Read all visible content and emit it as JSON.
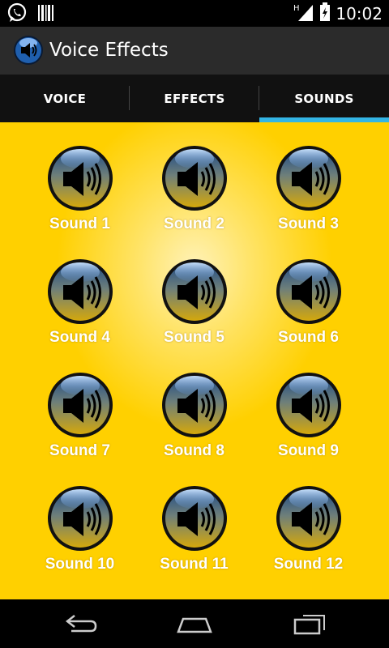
{
  "status_bar": {
    "time": "10:02",
    "icons": [
      "whatsapp-icon",
      "barcode-icon",
      "signal-icon",
      "battery-icon"
    ]
  },
  "action_bar": {
    "title": "Voice Effects",
    "icon": "speaker-icon"
  },
  "tabs": [
    {
      "label": "VOICE",
      "selected": false
    },
    {
      "label": "EFFECTS",
      "selected": false
    },
    {
      "label": "SOUNDS",
      "selected": true
    }
  ],
  "sounds": [
    {
      "label": "Sound 1"
    },
    {
      "label": "Sound 2"
    },
    {
      "label": "Sound 3"
    },
    {
      "label": "Sound 4"
    },
    {
      "label": "Sound 5"
    },
    {
      "label": "Sound 6"
    },
    {
      "label": "Sound 7"
    },
    {
      "label": "Sound 8"
    },
    {
      "label": "Sound 9"
    },
    {
      "label": "Sound 10"
    },
    {
      "label": "Sound 11"
    },
    {
      "label": "Sound 12"
    }
  ],
  "nav_bar": {
    "icons": [
      "back-icon",
      "home-icon",
      "recent-apps-icon"
    ]
  },
  "colors": {
    "background": "#ffcc00",
    "tab_indicator": "#33b5e5",
    "action_bar": "#2b2b2b"
  }
}
